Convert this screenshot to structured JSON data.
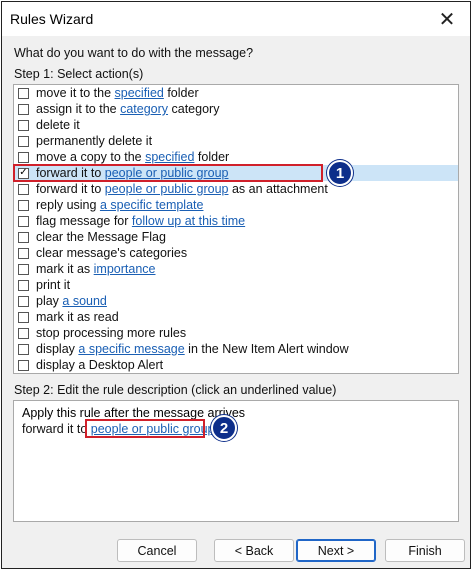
{
  "window": {
    "title": "Rules Wizard",
    "close_glyph": "✕"
  },
  "question": "What do you want to do with the message?",
  "step1_label": "Step 1: Select action(s)",
  "actions": [
    {
      "parts": [
        "move it to the ",
        "specified",
        " folder"
      ],
      "checked": false
    },
    {
      "parts": [
        "assign it to the ",
        "category",
        " category"
      ],
      "checked": false
    },
    {
      "parts": [
        "delete it"
      ],
      "checked": false
    },
    {
      "parts": [
        "permanently delete it"
      ],
      "checked": false
    },
    {
      "parts": [
        "move a copy to the ",
        "specified",
        " folder"
      ],
      "checked": false
    },
    {
      "parts": [
        "forward it to ",
        "people or public group",
        ""
      ],
      "checked": true
    },
    {
      "parts": [
        "forward it to ",
        "people or public group",
        " as an attachment"
      ],
      "checked": false
    },
    {
      "parts": [
        "reply using ",
        "a specific template",
        ""
      ],
      "checked": false
    },
    {
      "parts": [
        "flag message for ",
        "follow up at this time",
        ""
      ],
      "checked": false
    },
    {
      "parts": [
        "clear the Message Flag"
      ],
      "checked": false
    },
    {
      "parts": [
        "clear message's categories"
      ],
      "checked": false
    },
    {
      "parts": [
        "mark it as ",
        "importance",
        ""
      ],
      "checked": false
    },
    {
      "parts": [
        "print it"
      ],
      "checked": false
    },
    {
      "parts": [
        "play ",
        "a sound",
        ""
      ],
      "checked": false
    },
    {
      "parts": [
        "mark it as read"
      ],
      "checked": false
    },
    {
      "parts": [
        "stop processing more rules"
      ],
      "checked": false
    },
    {
      "parts": [
        "display ",
        "a specific message",
        " in the New Item Alert window"
      ],
      "checked": false
    },
    {
      "parts": [
        "display a Desktop Alert"
      ],
      "checked": false
    }
  ],
  "check_glyph": "✓",
  "step2_label": "Step 2: Edit the rule description (click an underlined value)",
  "description": {
    "line1": "Apply this rule after the message arrives",
    "line2_prefix": "forward it to ",
    "line2_link": "people or public group"
  },
  "markers": {
    "one": "1",
    "two": "2"
  },
  "buttons": {
    "cancel": "Cancel",
    "back": "< Back",
    "next": "Next >",
    "finish": "Finish"
  },
  "colors": {
    "link": "#1a5fb4",
    "selection": "#cce4f7",
    "highlight_border": "#d0202a",
    "marker": "#0d2e8a"
  }
}
